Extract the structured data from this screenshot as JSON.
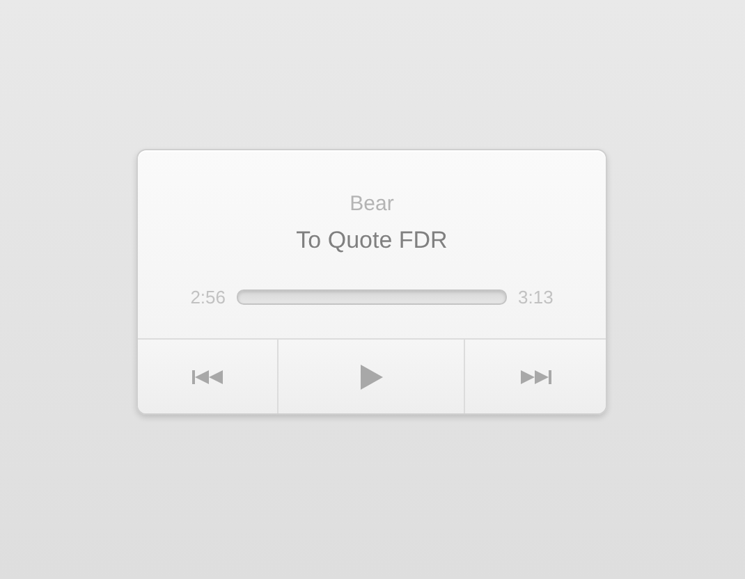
{
  "player": {
    "artist": "Bear",
    "title": "To Quote FDR",
    "elapsed": "2:56",
    "duration": "3:13",
    "controls": [
      {
        "kind": "previous"
      },
      {
        "kind": "play"
      },
      {
        "kind": "next"
      }
    ]
  }
}
